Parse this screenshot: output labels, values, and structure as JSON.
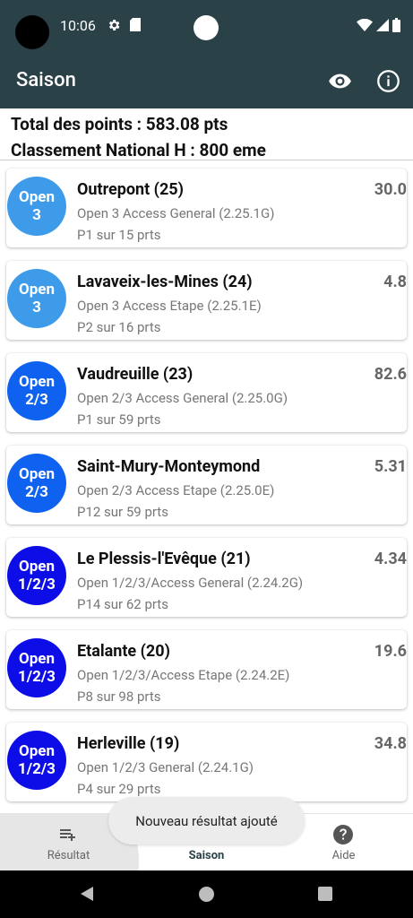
{
  "status": {
    "time": "10:06"
  },
  "appbar": {
    "title": "Saison",
    "eye_icon": "eye-icon",
    "info_icon": "info-icon"
  },
  "summary": {
    "total": "Total des points : 583.08 pts",
    "ranking": "Classement National H : 800 eme"
  },
  "colors": {
    "bar": "#2b4148",
    "open3": "#3d9be9",
    "open23": "#0f62f0",
    "open123": "#0d0de8"
  },
  "results": [
    {
      "badge_l1": "Open",
      "badge_l2": "3",
      "title": "Outrepont (25)",
      "sub": "Open 3 Access General (2.25.1G)",
      "rank": "P1 sur 15 prts",
      "points": "30.0",
      "color": "#3d9be9"
    },
    {
      "badge_l1": "Open",
      "badge_l2": "3",
      "title": "Lavaveix-les-Mines (24)",
      "sub": "Open 3 Access Etape (2.25.1E)",
      "rank": "P2 sur 16 prts",
      "points": "4.8",
      "color": "#3d9be9"
    },
    {
      "badge_l1": "Open",
      "badge_l2": "2/3",
      "title": "Vaudreuille (23)",
      "sub": "Open 2/3 Access General (2.25.0G)",
      "rank": "P1 sur 59 prts",
      "points": "82.6",
      "color": "#0f62f0"
    },
    {
      "badge_l1": "Open",
      "badge_l2": "2/3",
      "title": "Saint-Mury-Monteymond",
      "sub": "Open 2/3 Access Etape (2.25.0E)",
      "rank": "P12 sur 59 prts",
      "points": "5.31",
      "color": "#0f62f0"
    },
    {
      "badge_l1": "Open",
      "badge_l2": "1/2/3",
      "title": "Le Plessis-l'Evêque (21)",
      "sub": "Open 1/2/3/Access General (2.24.2G)",
      "rank": "P14 sur 62 prts",
      "points": "4.34",
      "color": "#0d0de8"
    },
    {
      "badge_l1": "Open",
      "badge_l2": "1/2/3",
      "title": "Etalante (20)",
      "sub": "Open 1/2/3/Access Etape (2.24.2E)",
      "rank": "P8 sur 98 prts",
      "points": "19.6",
      "color": "#0d0de8"
    },
    {
      "badge_l1": "Open",
      "badge_l2": "1/2/3",
      "title": "Herleville (19)",
      "sub": "Open 1/2/3 General (2.24.1G)",
      "rank": "P4 sur 29 prts",
      "points": "34.8",
      "color": "#0d0de8"
    }
  ],
  "nav": [
    {
      "label": "Résultat",
      "icon": "playlist-add-icon"
    },
    {
      "label": "Saison",
      "icon": "list-icon",
      "active": true
    },
    {
      "label": "Aide",
      "icon": "help-icon"
    }
  ],
  "toast": "Nouveau résultat ajouté"
}
